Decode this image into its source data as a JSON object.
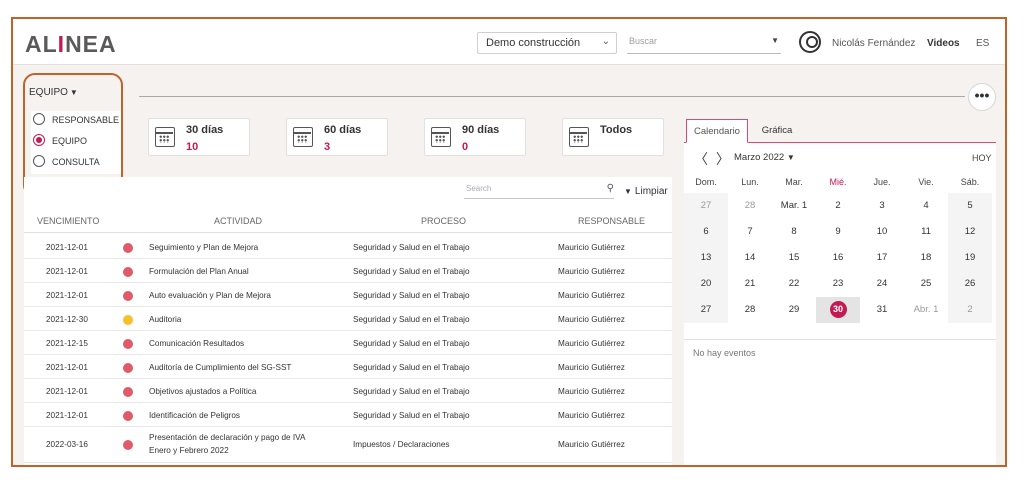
{
  "header": {
    "logo_pre": "AL",
    "logo_i": "I",
    "logo_post": "NEA",
    "company_select": "Demo construcción",
    "search_placeholder": "Buscar",
    "user_name": "Nicolás Fernández",
    "videos": "Videos",
    "lang": "ES"
  },
  "toolbar": {
    "view_label": "EQUIPO",
    "more": "•••"
  },
  "role_options": [
    {
      "label": "RESPONSABLE",
      "checked": false
    },
    {
      "label": "EQUIPO",
      "checked": true
    },
    {
      "label": "CONSULTA",
      "checked": false
    }
  ],
  "summary_cards": [
    {
      "title": "30 días",
      "count": "10"
    },
    {
      "title": "60 días",
      "count": "3"
    },
    {
      "title": "90 días",
      "count": "0"
    },
    {
      "title": "Todos",
      "count": ""
    }
  ],
  "table": {
    "search_placeholder": "Search",
    "filter_label": "Limpiar",
    "headers": [
      "VENCIMIENTO",
      "ACTIVIDAD",
      "PROCESO",
      "RESPONSABLE"
    ],
    "rows": [
      {
        "date": "2021-12-01",
        "status_color": "#e05a6a",
        "activity": "Seguimiento y Plan de Mejora",
        "activity2": "",
        "process": "Seguridad y Salud en el Trabajo",
        "owner": "Mauricio Gutiérrez"
      },
      {
        "date": "2021-12-01",
        "status_color": "#e05a6a",
        "activity": "Formulación del  Plan Anual",
        "activity2": "",
        "process": "Seguridad y Salud en el Trabajo",
        "owner": "Mauricio Gutiérrez"
      },
      {
        "date": "2021-12-01",
        "status_color": "#e05a6a",
        "activity": "Auto evaluación y Plan de Mejora",
        "activity2": "",
        "process": "Seguridad y Salud en el Trabajo",
        "owner": "Mauricio Gutiérrez"
      },
      {
        "date": "2021-12-30",
        "status_color": "#f5c02a",
        "activity": "Auditoria",
        "activity2": "",
        "process": "Seguridad y Salud en el Trabajo",
        "owner": "Mauricio Gutiérrez"
      },
      {
        "date": "2021-12-15",
        "status_color": "#e05a6a",
        "activity": "Comunicación Resultados",
        "activity2": "",
        "process": "Seguridad y Salud en el Trabajo",
        "owner": "Mauricio Gutiérrez"
      },
      {
        "date": "2021-12-01",
        "status_color": "#e05a6a",
        "activity": "Auditoría de Cumplimiento del SG-SST",
        "activity2": "",
        "process": "Seguridad y Salud en el Trabajo",
        "owner": "Mauricio Gutiérrez"
      },
      {
        "date": "2021-12-01",
        "status_color": "#e05a6a",
        "activity": "Objetivos ajustados a Política",
        "activity2": "",
        "process": "Seguridad y Salud en el Trabajo",
        "owner": "Mauricio Gutiérrez"
      },
      {
        "date": "2021-12-01",
        "status_color": "#e05a6a",
        "activity": "Identificación de Peligros",
        "activity2": "",
        "process": "Seguridad y Salud en el Trabajo",
        "owner": "Mauricio Gutiérrez"
      },
      {
        "date": "2022-03-16",
        "status_color": "#e05a6a",
        "activity": "Presentación  de  declaración  y  pago  de  IVA",
        "activity2": "Enero y Febrero 2022",
        "process": "Impuestos / Declaraciones",
        "owner": "Mauricio Gutiérrez"
      }
    ]
  },
  "calendar": {
    "tabs": [
      "Calendario",
      "Gráfica"
    ],
    "active_tab": 0,
    "prev": "〈",
    "next": "〉",
    "month": "Marzo 2022",
    "today": "HOY",
    "weekdays": [
      "Dom.",
      "Lun.",
      "Mar.",
      "Mié.",
      "Jue.",
      "Vie.",
      "Sáb."
    ],
    "weeks": [
      [
        "27",
        "28",
        "Mar. 1",
        "2",
        "3",
        "4",
        "5"
      ],
      [
        "6",
        "7",
        "8",
        "9",
        "10",
        "11",
        "12"
      ],
      [
        "13",
        "14",
        "15",
        "16",
        "17",
        "18",
        "19"
      ],
      [
        "20",
        "21",
        "22",
        "23",
        "24",
        "25",
        "26"
      ],
      [
        "27",
        "28",
        "29",
        "30",
        "31",
        "Abr. 1",
        "2"
      ]
    ],
    "selected_day": "30",
    "no_events": "No hay eventos"
  },
  "colors": {
    "accent": "#c41a52",
    "highlight_border": "#c0632a"
  }
}
